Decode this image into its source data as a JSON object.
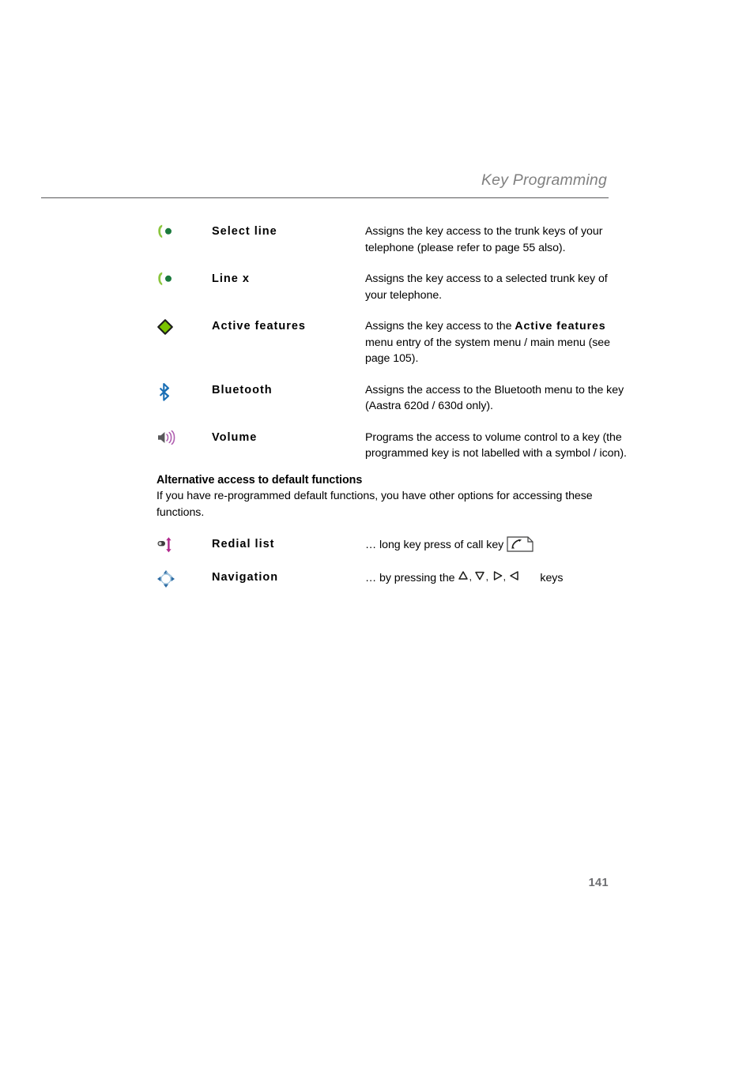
{
  "header": {
    "title": "Key Programming"
  },
  "functions": {
    "rows": [
      {
        "icon": "line-handset-icon",
        "label": "Select line",
        "desc_html": "Assigns the key access to the trunk keys of your telephone (please refer to page 55 also)."
      },
      {
        "icon": "line-handset-icon",
        "label": "Line x",
        "desc_html": "Assigns the key access to a selected trunk key of your telephone."
      },
      {
        "icon": "green-diamond-icon",
        "label": "Active features",
        "desc_html": "Assigns the key access to the <b>Active features</b> menu entry of the system menu / main menu (see page 105)."
      },
      {
        "icon": "bluetooth-icon",
        "label": "Bluetooth",
        "desc_html": "Assigns the access to the Bluetooth menu to the key (Aastra 620d / 630d only)."
      },
      {
        "icon": "volume-speaker-icon",
        "label": "Volume",
        "desc_html": "Programs the access to volume control to a key (the programmed key is not labelled with a symbol / icon)."
      }
    ]
  },
  "alternative_access": {
    "heading": "Alternative access to default functions",
    "paragraph": "If you have re-programmed default functions, you have other options for accessing these functions.",
    "rows": [
      {
        "icon": "redial-list-icon",
        "label": "Redial list",
        "desc_prefix": "… long key press of call key",
        "desc_suffix": "",
        "inline_icon": "call-key-icon"
      },
      {
        "icon": "navigation-key-icon",
        "label": "Navigation",
        "desc_prefix": "… by pressing the",
        "desc_suffix": "keys",
        "inline_icon": "arrow-keys-icon",
        "arrow_separators": [
          ", ",
          ", ",
          ", "
        ]
      }
    ]
  },
  "footer": {
    "page_number": "141"
  },
  "colors": {
    "header_gray": "#808080",
    "rule_gray": "#58585a",
    "page_number_gray": "#6d6e71",
    "icon_green_light": "#8cc63f",
    "icon_green_dark": "#1b7a3d",
    "icon_diamond_green": "#7ac400",
    "icon_bluetooth_blue": "#1a6fb5",
    "icon_speaker_gray": "#58585a",
    "icon_wave_purple": "#b05fb0",
    "icon_magenta": "#b0288c",
    "icon_nav_blue": "#2e6da4"
  }
}
